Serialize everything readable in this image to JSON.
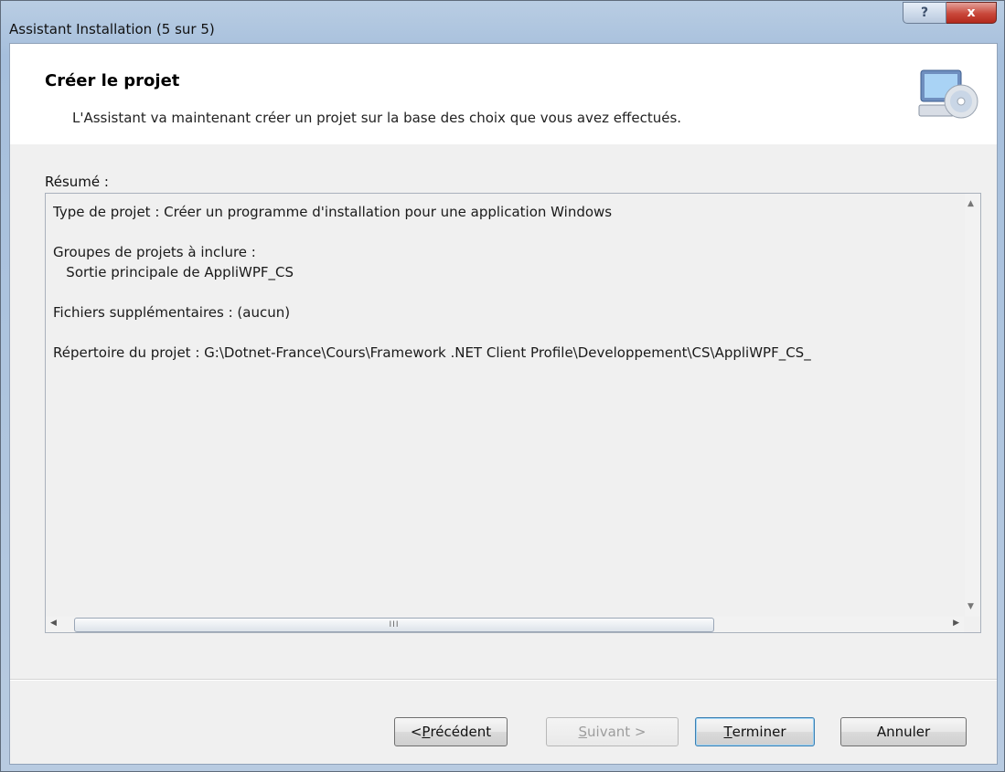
{
  "window": {
    "title": "Assistant Installation (5 sur 5)",
    "help_label": "?",
    "close_label": "x"
  },
  "header": {
    "title": "Créer le projet",
    "subtitle": "L'Assistant va maintenant créer un projet sur la base des choix que vous avez effectués.",
    "icon": "computer-cd-icon"
  },
  "summary": {
    "label": "Résumé :",
    "text": "Type de projet : Créer un programme d'installation pour une application Windows\n\nGroupes de projets à inclure :\n   Sortie principale de AppliWPF_CS\n\nFichiers supplémentaires : (aucun)\n\nRépertoire du projet : G:\\Dotnet-France\\Cours\\Framework .NET Client Profile\\Developpement\\CS\\AppliWPF_CS_",
    "scroll_thumb_grip": "III"
  },
  "buttons": {
    "previous": {
      "prefix": "< ",
      "mnemonic": "P",
      "rest": "récédent"
    },
    "next": {
      "mnemonic": "S",
      "rest": "uivant >",
      "enabled": false
    },
    "finish": {
      "mnemonic": "T",
      "rest": "erminer"
    },
    "cancel": {
      "label": "Annuler"
    }
  },
  "colors": {
    "titlebar": "#a6bfdc",
    "close_button": "#c9473a",
    "client_background": "#f0f0f0",
    "header_background": "#ffffff"
  }
}
